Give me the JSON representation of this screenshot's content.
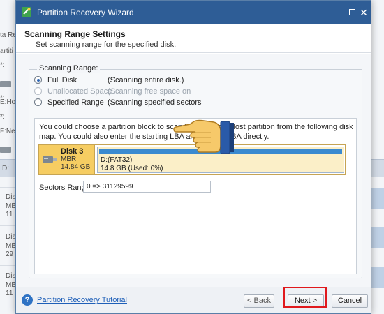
{
  "background_app": {
    "fragments": [
      {
        "text": "ta Re"
      },
      {
        "text": "artiti"
      },
      {
        "text": "*:"
      },
      {
        "text": "*:"
      },
      {
        "text": "E:Ho"
      },
      {
        "text": "*:"
      },
      {
        "text": "F:Ne"
      },
      {
        "text": "D:"
      },
      {
        "text": "Dis"
      },
      {
        "text": "MB"
      },
      {
        "text": "11"
      },
      {
        "text": "Dis"
      },
      {
        "text": "MB"
      },
      {
        "text": "29"
      },
      {
        "text": "Dis"
      },
      {
        "text": "MB"
      },
      {
        "text": "11"
      }
    ]
  },
  "window": {
    "title": "Partition Recovery Wizard",
    "maximize_glyph": "",
    "close_glyph": "✕"
  },
  "header": {
    "title": "Scanning Range Settings",
    "subtitle": "Set scanning range for the specified disk."
  },
  "scanning_range": {
    "legend": "Scanning Range:",
    "options": [
      {
        "label": "Full Disk",
        "description": "(Scanning entire disk.)",
        "selected": true,
        "enabled": true
      },
      {
        "label": "Unallocated Space",
        "description": "(Scanning free space on",
        "selected": false,
        "enabled": false
      },
      {
        "label": "Specified Range",
        "description": "(Scanning specified sectors",
        "selected": false,
        "enabled": true
      }
    ]
  },
  "disk_map": {
    "description": "You could choose a partition block to scan the deleted or lost partition from the following disk map. You could also enter the starting LBA and Ending LBA directly.",
    "disk": {
      "name": "Disk 3",
      "type": "MBR",
      "size": "14.84 GB"
    },
    "partition": {
      "name": "D:(FAT32)",
      "size_text": "14.8 GB (Used: 0%)",
      "bar_color": "#3a8ad0",
      "used_fraction": 0
    },
    "sectors_range_label": "Sectors Range:",
    "sectors_range_value": "0 => 31129599"
  },
  "footer": {
    "tutorial_label": "Partition Recovery Tutorial",
    "help_glyph": "?",
    "back_label": "< Back",
    "next_label": "Next >",
    "cancel_label": "Cancel"
  },
  "annotations": {
    "highlight_color": "#e0191d",
    "pointer": "hand-pointer-icon"
  },
  "colors": {
    "titlebar": "#2e5d96",
    "disk_info": "#f6cd62",
    "link": "#1e5fb8"
  }
}
